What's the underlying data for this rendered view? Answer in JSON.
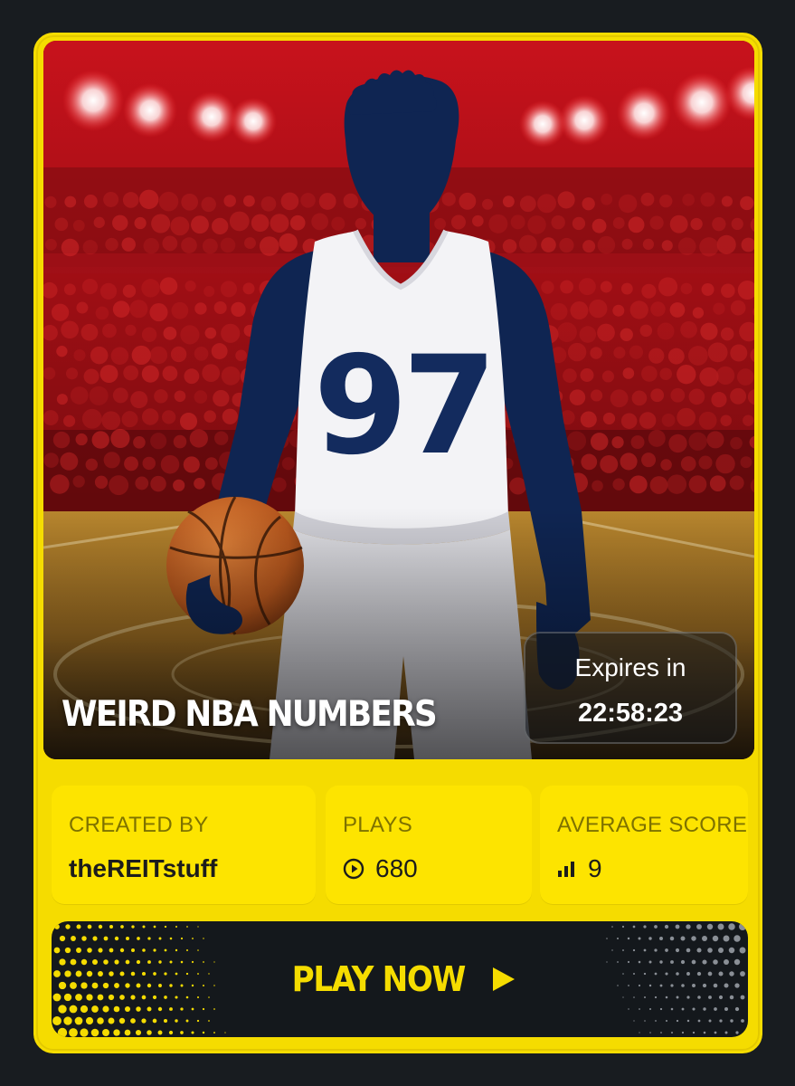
{
  "card": {
    "title": "WEIRD NBA NUMBERS",
    "jersey_number": "97",
    "expires_label": "Expires in",
    "expires_time": "22:58:23"
  },
  "stats": [
    {
      "label": "CREATED BY",
      "value": "theREITstuff",
      "icon": ""
    },
    {
      "label": "PLAYS",
      "value": "680",
      "icon": "play-circle-icon"
    },
    {
      "label": "AVERAGE SCORE",
      "value": "9",
      "icon": "bar-chart-icon"
    }
  ],
  "play_button": {
    "label": "PLAY NOW",
    "icon": "play-arrow-icon"
  },
  "colors": {
    "accent": "#f5dc00",
    "background": "#181c20",
    "navy": "#0f2552",
    "arena_red": "#b5121b"
  }
}
